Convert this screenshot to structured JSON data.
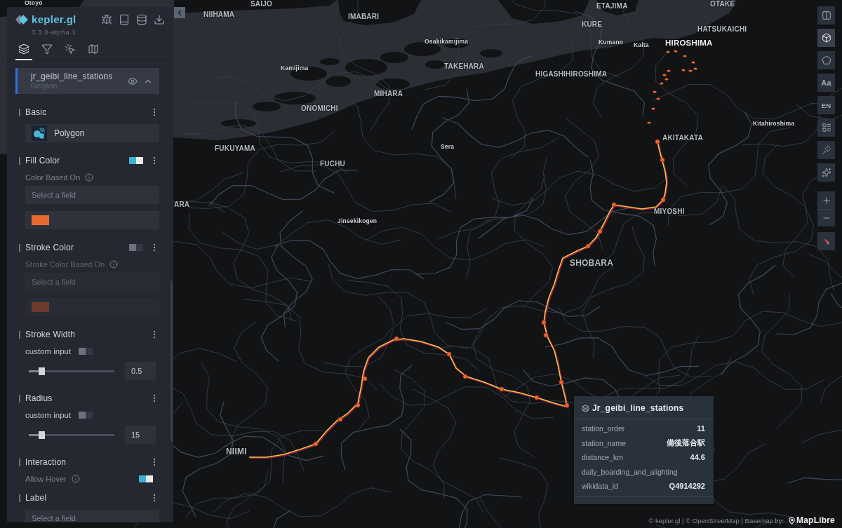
{
  "map": {
    "labels": [
      {
        "text": "Otoyo",
        "kind": "town"
      },
      {
        "text": "SAIJO",
        "kind": "city"
      },
      {
        "text": "NIIHAMA",
        "kind": "city"
      },
      {
        "text": "IMABARI",
        "kind": "city"
      },
      {
        "text": "ETAJIMA",
        "kind": "city"
      },
      {
        "text": "OTAKE",
        "kind": "city"
      },
      {
        "text": "KURE",
        "kind": "city"
      },
      {
        "text": "HATSUKAICHI",
        "kind": "city"
      },
      {
        "text": "Osakikamijima",
        "kind": "town"
      },
      {
        "text": "Kumano",
        "kind": "town"
      },
      {
        "text": "Kaita",
        "kind": "town"
      },
      {
        "text": "HIROSHIMA",
        "kind": "major"
      },
      {
        "text": "TAKEHARA",
        "kind": "city"
      },
      {
        "text": "Kamijima",
        "kind": "town"
      },
      {
        "text": "HIGASHIHIROSHIMA",
        "kind": "city"
      },
      {
        "text": "MIHARA",
        "kind": "city"
      },
      {
        "text": "ONOMICHI",
        "kind": "city"
      },
      {
        "text": "Kitahiroshima",
        "kind": "town"
      },
      {
        "text": "AKITAKATA",
        "kind": "city"
      },
      {
        "text": "Sera",
        "kind": "town"
      },
      {
        "text": "FUKUYAMA",
        "kind": "city"
      },
      {
        "text": "FUCHU",
        "kind": "city"
      },
      {
        "text": "ARA",
        "kind": "city"
      },
      {
        "text": "MIYOSHI",
        "kind": "city"
      },
      {
        "text": "Jinsekikogen",
        "kind": "town"
      },
      {
        "text": "SHOBARA",
        "kind": "city"
      },
      {
        "text": "NIIMI",
        "kind": "city"
      }
    ]
  },
  "side_panel": {
    "app": {
      "name": "kepler.gl",
      "version": "3.3.0-alpha.1"
    },
    "tabs": [
      {
        "kind": "layers",
        "selected": true
      },
      {
        "kind": "filters",
        "selected": false
      },
      {
        "kind": "interactions",
        "selected": false
      },
      {
        "kind": "basemap",
        "selected": false
      }
    ],
    "layer": {
      "title": "jr_geibi_line_stations",
      "source_type": "Geojson",
      "visible": true,
      "expanded": true
    },
    "sections": [
      {
        "kind": "basic",
        "title": "Basic",
        "layer_type": "Polygon"
      },
      {
        "kind": "color",
        "title": "Fill Color",
        "on": true,
        "based_on_label": "Color Based On",
        "field": {
          "placeholder": "Select a field"
        },
        "color": "#e8692e"
      },
      {
        "kind": "color",
        "title": "Stroke Color",
        "on": false,
        "based_on_label": "Stroke Color Based On",
        "field": {
          "placeholder": "Select a field"
        },
        "color": "#6b3b2d"
      },
      {
        "kind": "slider",
        "title": "Stroke Width",
        "custom_input_label": "custom input",
        "custom_input": false,
        "level": 0.15,
        "value": "0.5"
      },
      {
        "kind": "slider",
        "title": "Radius",
        "custom_input_label": "custom input",
        "custom_input": false,
        "level": 0.15,
        "value": "15"
      },
      {
        "kind": "toggle",
        "title": "Interaction",
        "option_label": "Allow Hover",
        "on": true
      },
      {
        "kind": "select",
        "title": "Label",
        "field": {
          "placeholder": "Select a field"
        }
      }
    ]
  },
  "map_controls": [
    {
      "kind": "split",
      "active": false
    },
    {
      "kind": "view3d",
      "active": true
    },
    {
      "kind": "draw",
      "active": false
    },
    {
      "kind": "labels",
      "label": "Aa",
      "active": false
    },
    {
      "kind": "locale",
      "label": "EN",
      "active": false
    },
    {
      "kind": "legend",
      "active": false
    },
    {
      "kind": "measure",
      "active": false
    },
    {
      "kind": "effects",
      "active": false
    },
    {
      "kind": "zoom_in",
      "active": false
    },
    {
      "kind": "zoom_out",
      "active": false
    },
    {
      "kind": "compass",
      "active": false
    }
  ],
  "tooltip": {
    "title": "Jr_geibi_line_stations",
    "rows": [
      {
        "name": "station_order",
        "value": "11"
      },
      {
        "name": "station_name",
        "value": "備後落合駅"
      },
      {
        "name": "distance_km",
        "value": "44.6"
      },
      {
        "name": "daily_boarding_and_alighting"
      },
      {
        "name": "wikidata_id",
        "value": "Q4914292"
      }
    ]
  },
  "attribution": {
    "text": "© kepler.gl | © OpenStreetMap | Basemap by:",
    "brand": "MapLibre"
  }
}
